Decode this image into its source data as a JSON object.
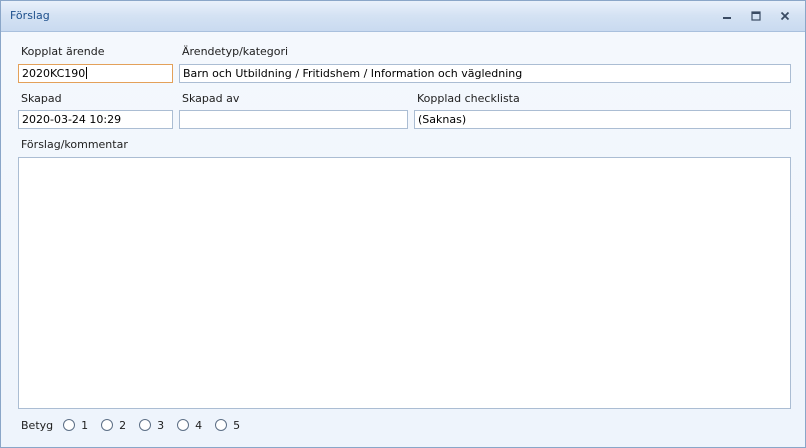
{
  "window": {
    "title": "Förslag"
  },
  "window_controls": [
    "minimize-icon",
    "maximize-icon",
    "close-icon"
  ],
  "form": {
    "case_label": "Kopplat ärende",
    "case_value": "2020KC190",
    "type_label": "Ärendetyp/kategori",
    "type_value": "Barn och Utbildning / Fritidshem / Information och vägledning",
    "created_label": "Skapad",
    "created_value": "2020-03-24 10:29",
    "created_by_label": "Skapad av",
    "created_by_value": "",
    "checklist_label": "Kopplad checklista",
    "checklist_value": "(Saknas)",
    "comment_label": "Förslag/kommentar",
    "comment_value": ""
  },
  "rating": {
    "label": "Betyg",
    "options": [
      "1",
      "2",
      "3",
      "4",
      "5"
    ],
    "selected": null
  }
}
